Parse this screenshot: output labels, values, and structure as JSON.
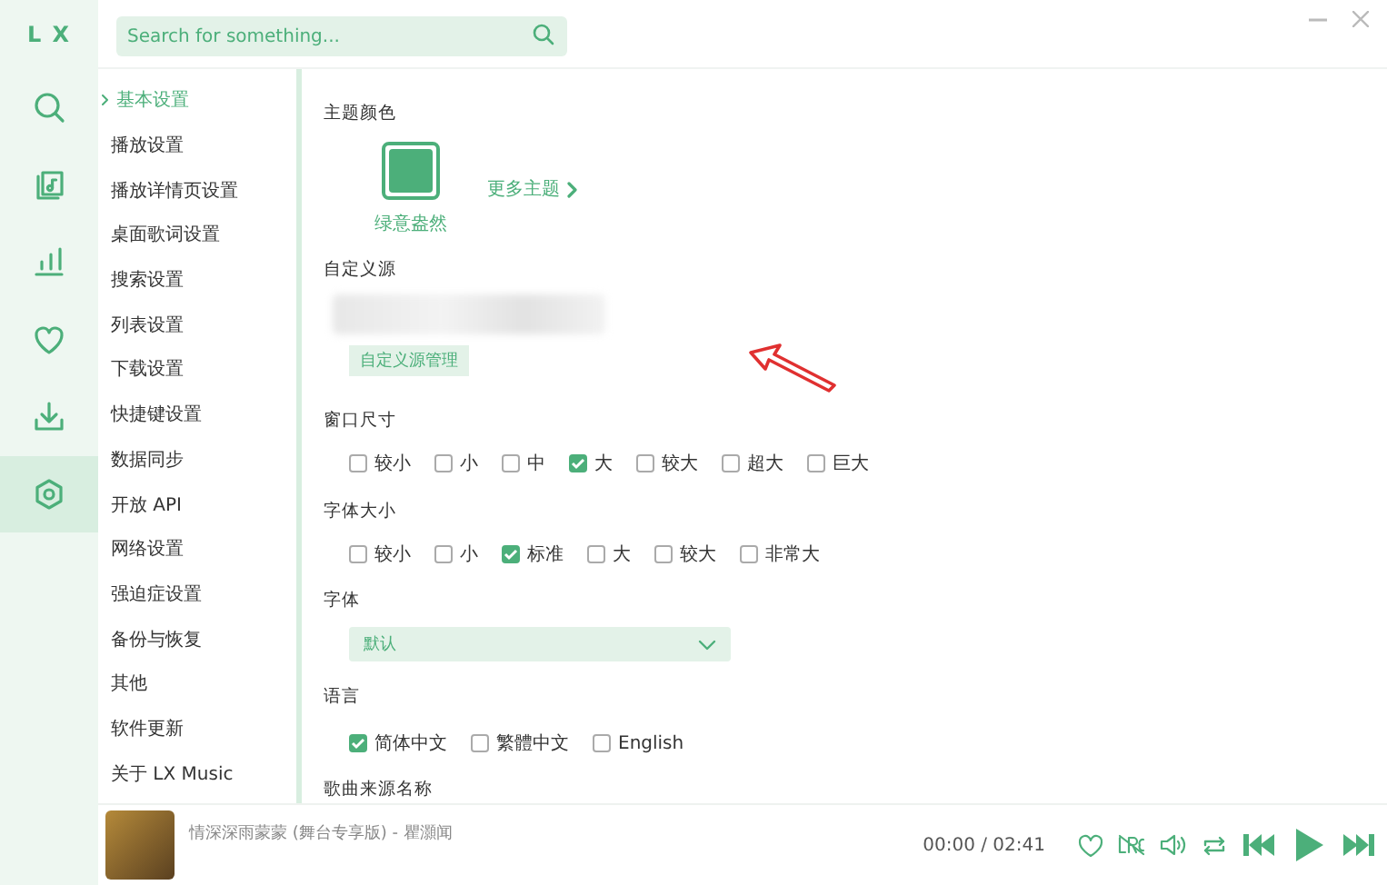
{
  "app": {
    "logo": "L X"
  },
  "rail": [
    {
      "kind": "search",
      "selected": false
    },
    {
      "kind": "music",
      "selected": false
    },
    {
      "kind": "chart",
      "selected": false
    },
    {
      "kind": "heart",
      "selected": false
    },
    {
      "kind": "download",
      "selected": false
    },
    {
      "kind": "settings",
      "selected": true
    }
  ],
  "search": {
    "placeholder": "Search for something..."
  },
  "nav": [
    {
      "label": "基本设置",
      "selected": true
    },
    {
      "label": "播放设置",
      "selected": false
    },
    {
      "label": "播放详情页设置",
      "selected": false
    },
    {
      "label": "桌面歌词设置",
      "selected": false
    },
    {
      "label": "搜索设置",
      "selected": false
    },
    {
      "label": "列表设置",
      "selected": false
    },
    {
      "label": "下载设置",
      "selected": false
    },
    {
      "label": "快捷键设置",
      "selected": false
    },
    {
      "label": "数据同步",
      "selected": false
    },
    {
      "label": "开放 API",
      "selected": false
    },
    {
      "label": "网络设置",
      "selected": false
    },
    {
      "label": "强迫症设置",
      "selected": false
    },
    {
      "label": "备份与恢复",
      "selected": false
    },
    {
      "label": "其他",
      "selected": false
    },
    {
      "label": "软件更新",
      "selected": false
    },
    {
      "label": "关于 LX Music",
      "selected": false
    }
  ],
  "theme": {
    "label": "主题颜色",
    "name": "绿意盎然",
    "color": "#4caf7a",
    "more": "更多主题"
  },
  "custom_source": {
    "label": "自定义源",
    "button": "自定义源管理"
  },
  "window_size": {
    "label": "窗口尺寸",
    "options": [
      {
        "label": "较小",
        "checked": false
      },
      {
        "label": "小",
        "checked": false
      },
      {
        "label": "中",
        "checked": false
      },
      {
        "label": "大",
        "checked": true
      },
      {
        "label": "较大",
        "checked": false
      },
      {
        "label": "超大",
        "checked": false
      },
      {
        "label": "巨大",
        "checked": false
      }
    ]
  },
  "font_size": {
    "label": "字体大小",
    "options": [
      {
        "label": "较小",
        "checked": false
      },
      {
        "label": "小",
        "checked": false
      },
      {
        "label": "标准",
        "checked": true
      },
      {
        "label": "大",
        "checked": false
      },
      {
        "label": "较大",
        "checked": false
      },
      {
        "label": "非常大",
        "checked": false
      }
    ]
  },
  "font": {
    "label": "字体",
    "value": "默认"
  },
  "language": {
    "label": "语言",
    "options": [
      {
        "label": "简体中文",
        "checked": true
      },
      {
        "label": "繁體中文",
        "checked": false
      },
      {
        "label": "English",
        "checked": false
      }
    ]
  },
  "source_name": {
    "label": "歌曲来源名称"
  },
  "player": {
    "title": "情深深雨蒙蒙 (舞台专享版) - 瞿灝闻",
    "time": "00:00 / 02:41"
  }
}
